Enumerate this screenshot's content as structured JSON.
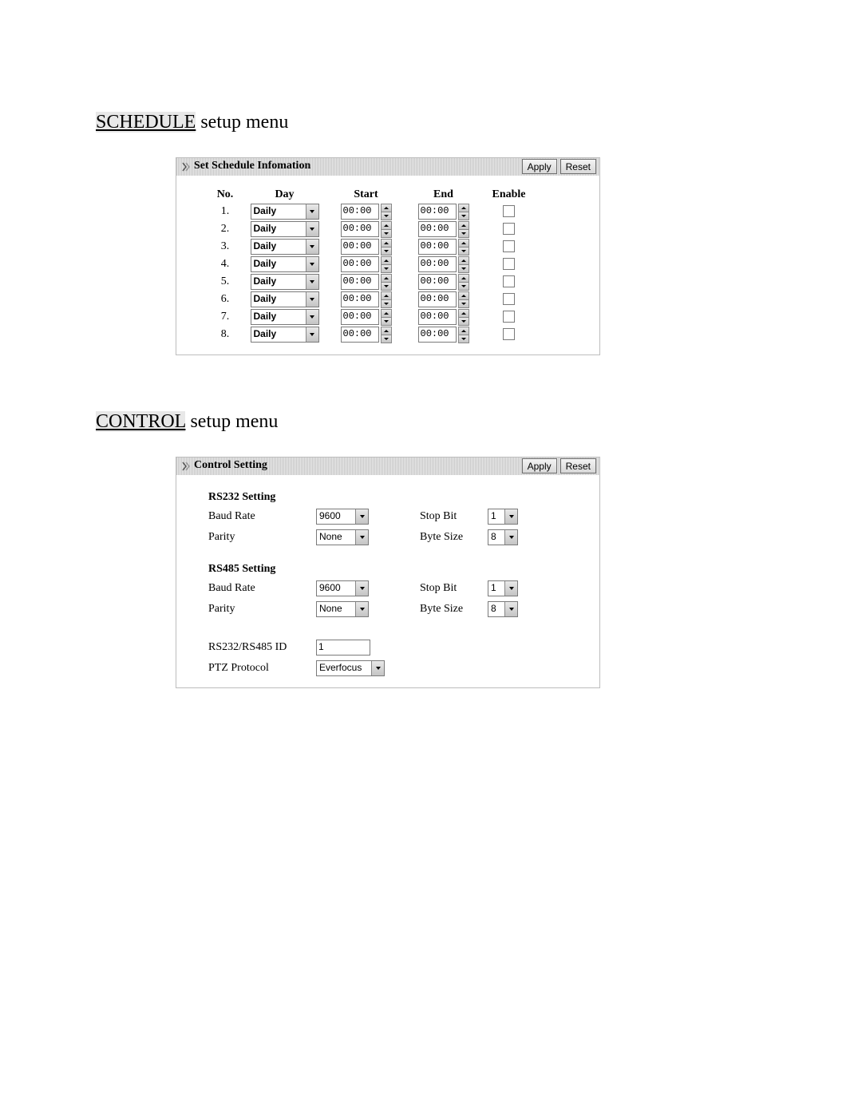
{
  "headings": {
    "schedule_kw": "SCHEDULE",
    "schedule_rest": " setup menu",
    "control_kw": "CONTROL",
    "control_rest": " setup menu"
  },
  "buttons": {
    "apply": "Apply",
    "reset": "Reset"
  },
  "schedule": {
    "panel_title": "Set Schedule Infomation",
    "headers": {
      "no": "No.",
      "day": "Day",
      "start": "Start",
      "end": "End",
      "enable": "Enable"
    },
    "rows": [
      {
        "no": "1.",
        "day": "Daily",
        "start": "00:00",
        "end": "00:00",
        "enable": false
      },
      {
        "no": "2.",
        "day": "Daily",
        "start": "00:00",
        "end": "00:00",
        "enable": false
      },
      {
        "no": "3.",
        "day": "Daily",
        "start": "00:00",
        "end": "00:00",
        "enable": false
      },
      {
        "no": "4.",
        "day": "Daily",
        "start": "00:00",
        "end": "00:00",
        "enable": false
      },
      {
        "no": "5.",
        "day": "Daily",
        "start": "00:00",
        "end": "00:00",
        "enable": false
      },
      {
        "no": "6.",
        "day": "Daily",
        "start": "00:00",
        "end": "00:00",
        "enable": false
      },
      {
        "no": "7.",
        "day": "Daily",
        "start": "00:00",
        "end": "00:00",
        "enable": false
      },
      {
        "no": "8.",
        "day": "Daily",
        "start": "00:00",
        "end": "00:00",
        "enable": false
      }
    ]
  },
  "control": {
    "panel_title": "Control Setting",
    "labels": {
      "baud": "Baud Rate",
      "parity": "Parity",
      "stopbit": "Stop Bit",
      "bytesize": "Byte Size",
      "rsid": "RS232/RS485 ID",
      "ptz": "PTZ Protocol"
    },
    "rs232": {
      "title": "RS232 Setting",
      "baud": "9600",
      "parity": "None",
      "stopbit": "1",
      "bytesize": "8"
    },
    "rs485": {
      "title": "RS485 Setting",
      "baud": "9600",
      "parity": "None",
      "stopbit": "1",
      "bytesize": "8"
    },
    "rsid": "1",
    "ptz_protocol": "Everfocus"
  }
}
